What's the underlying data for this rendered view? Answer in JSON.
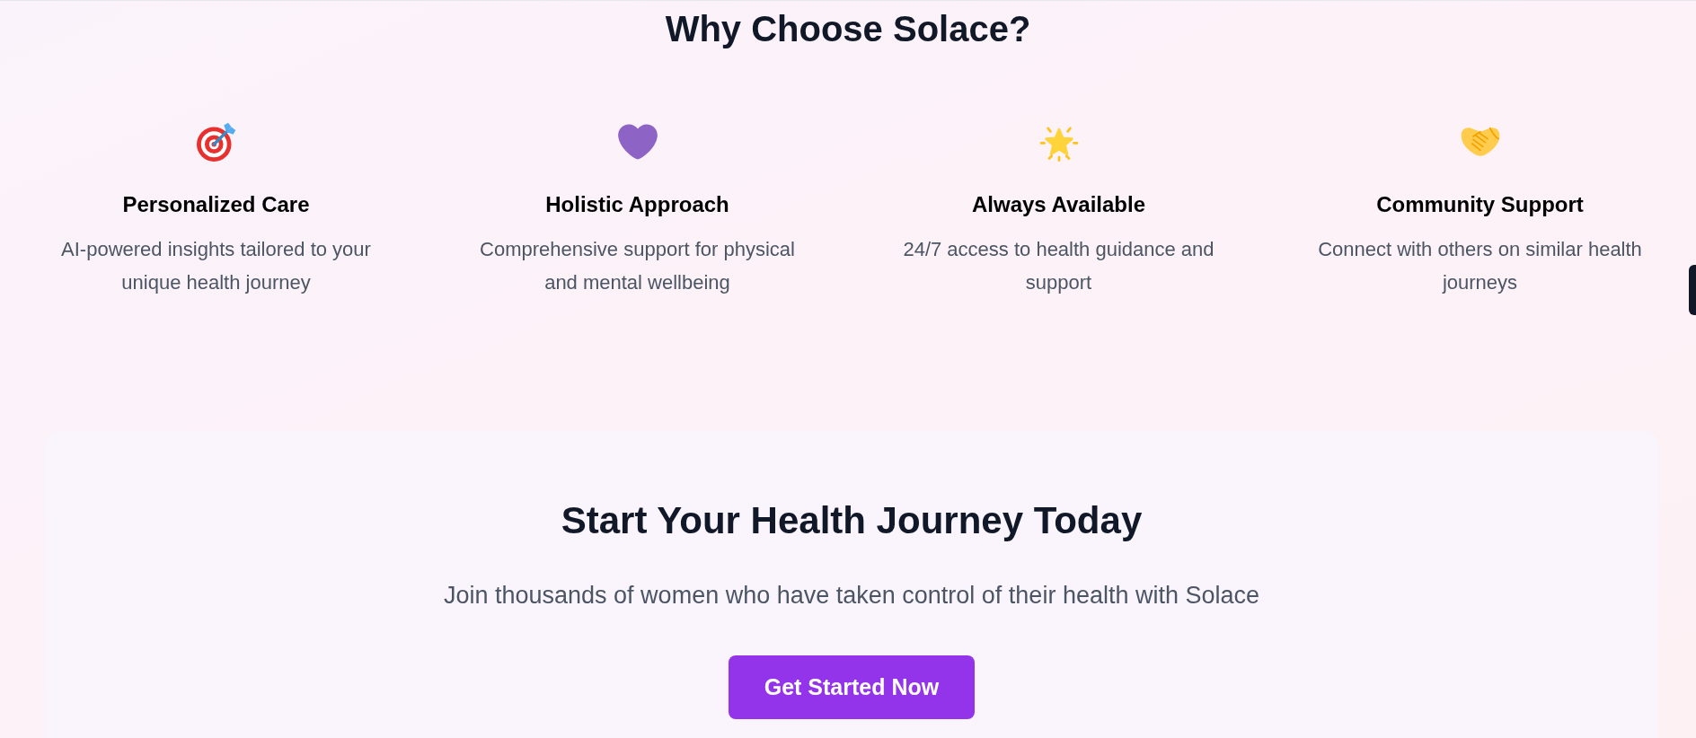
{
  "heading": "Why Choose Solace?",
  "features": [
    {
      "title": "Personalized Care",
      "description": "AI-powered insights tailored to your unique health journey"
    },
    {
      "title": "Holistic Approach",
      "description": "Comprehensive support for physical and mental wellbeing"
    },
    {
      "title": "Always Available",
      "description": "24/7 access to health guidance and support"
    },
    {
      "title": "Community Support",
      "description": "Connect with others on similar health journeys"
    }
  ],
  "cta": {
    "title": "Start Your Health Journey Today",
    "subtitle": "Join thousands of women who have taken control of their health with Solace",
    "button": "Get Started Now"
  }
}
